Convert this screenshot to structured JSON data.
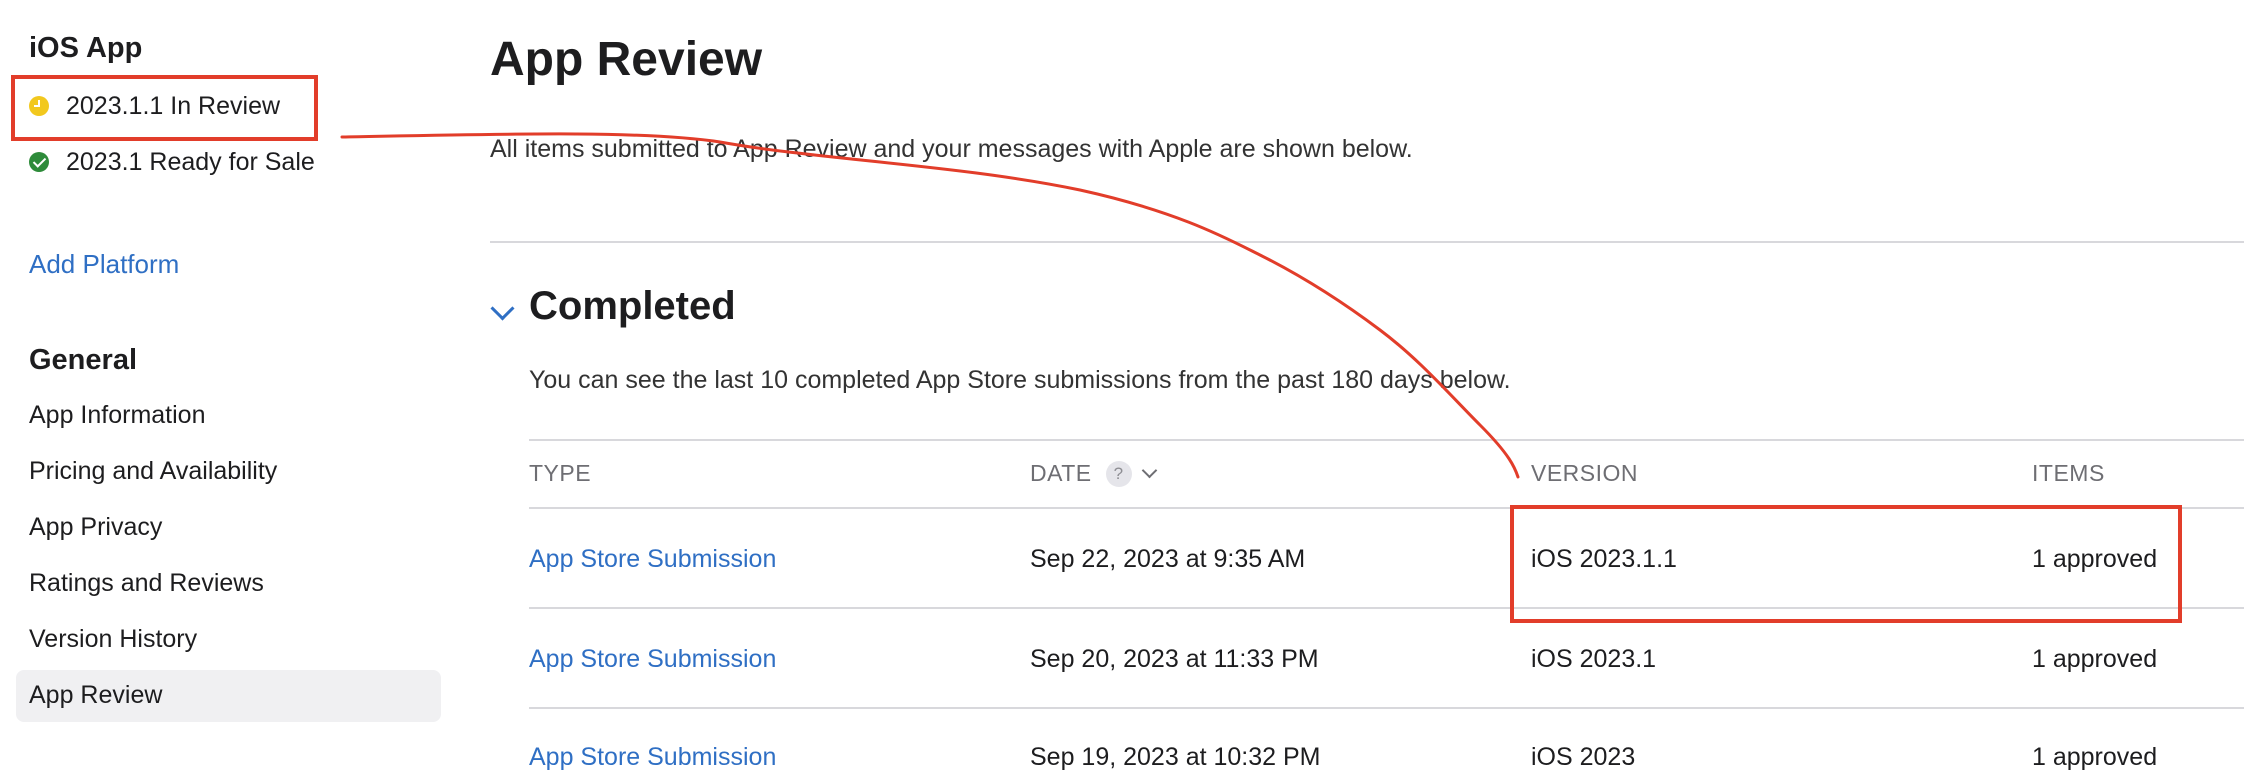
{
  "sidebar": {
    "app_heading": "iOS App",
    "statuses": [
      {
        "label": "2023.1.1 In Review",
        "state": "in-review"
      },
      {
        "label": "2023.1 Ready for Sale",
        "state": "ready"
      }
    ],
    "add_platform": "Add Platform",
    "general_heading": "General",
    "items": [
      {
        "label": "App Information"
      },
      {
        "label": "Pricing and Availability"
      },
      {
        "label": "App Privacy"
      },
      {
        "label": "Ratings and Reviews"
      },
      {
        "label": "Version History"
      },
      {
        "label": "App Review",
        "active": true
      }
    ]
  },
  "main": {
    "title": "App Review",
    "subtitle": "All items submitted to App Review and your messages with Apple are shown below.",
    "section": {
      "title": "Completed",
      "description": "You can see the last 10 completed App Store submissions from the past 180 days below."
    },
    "table": {
      "headers": {
        "type": "TYPE",
        "date": "DATE",
        "version": "VERSION",
        "items": "ITEMS"
      },
      "help_glyph": "?",
      "rows": [
        {
          "type": "App Store Submission",
          "date": "Sep 22, 2023 at 9:35 AM",
          "version": "iOS 2023.1.1",
          "items": "1 approved"
        },
        {
          "type": "App Store Submission",
          "date": "Sep 20, 2023 at 11:33 PM",
          "version": "iOS 2023.1",
          "items": "1 approved"
        },
        {
          "type": "App Store Submission",
          "date": "Sep 19, 2023 at 10:32 PM",
          "version": "iOS 2023",
          "items": "1 approved"
        }
      ]
    }
  },
  "colors": {
    "accent": "#2f6fc4",
    "annotation": "#e23d2a",
    "status_in_review": "#f2c81e",
    "status_ready": "#2e8b3a"
  }
}
